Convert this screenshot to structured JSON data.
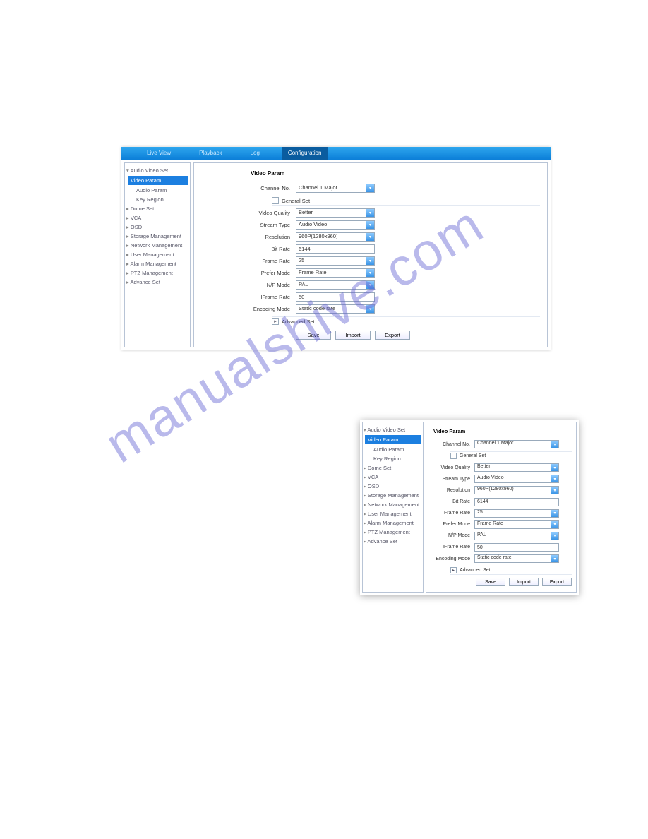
{
  "watermark": "manualshive.com",
  "topbar": {
    "tabs": [
      {
        "label": "Live View"
      },
      {
        "label": "Playback"
      },
      {
        "label": "Log"
      },
      {
        "label": "Configuration",
        "active": true
      }
    ]
  },
  "sidebar": {
    "items": [
      {
        "label": "Audio Video Set",
        "kind": "top"
      },
      {
        "label": "Video Param",
        "kind": "sub",
        "selected": true
      },
      {
        "label": "Audio Param",
        "kind": "sub"
      },
      {
        "label": "Key Region",
        "kind": "sub"
      },
      {
        "label": "Dome Set",
        "kind": "collapsed"
      },
      {
        "label": "VCA",
        "kind": "collapsed"
      },
      {
        "label": "OSD",
        "kind": "collapsed"
      },
      {
        "label": "Storage Management",
        "kind": "collapsed"
      },
      {
        "label": "Network Management",
        "kind": "collapsed"
      },
      {
        "label": "User Management",
        "kind": "collapsed"
      },
      {
        "label": "Alarm Management",
        "kind": "collapsed"
      },
      {
        "label": "PTZ Management",
        "kind": "collapsed"
      },
      {
        "label": "Advance Set",
        "kind": "collapsed"
      }
    ]
  },
  "panel": {
    "title": "Video Param",
    "channel_label": "Channel No.",
    "channel_value": "Channel 1 Major",
    "general_label": "General Set",
    "advanced_label": "Advanced Set",
    "fields": {
      "video_quality": {
        "label": "Video Quality",
        "value": "Better",
        "dd": true
      },
      "stream_type": {
        "label": "Stream Type",
        "value": "Audio Video",
        "dd": true
      },
      "resolution": {
        "label": "Resolution",
        "value": "960P(1280x960)",
        "dd": true
      },
      "bit_rate": {
        "label": "Bit Rate",
        "value": "6144",
        "dd": false
      },
      "frame_rate": {
        "label": "Frame Rate",
        "value": "25",
        "dd": true
      },
      "prefer_mode": {
        "label": "Prefer Mode",
        "value": "Frame Rate",
        "dd": true
      },
      "np_mode": {
        "label": "N/P Mode",
        "value": "PAL",
        "dd": true
      },
      "iframe_rate": {
        "label": "IFrame Rate",
        "value": "50",
        "dd": false
      },
      "encoding_mode": {
        "label": "Encoding Mode",
        "value": "Static code rate",
        "dd": true
      }
    },
    "buttons": {
      "save": "Save",
      "import": "Import",
      "export": "Export"
    }
  }
}
